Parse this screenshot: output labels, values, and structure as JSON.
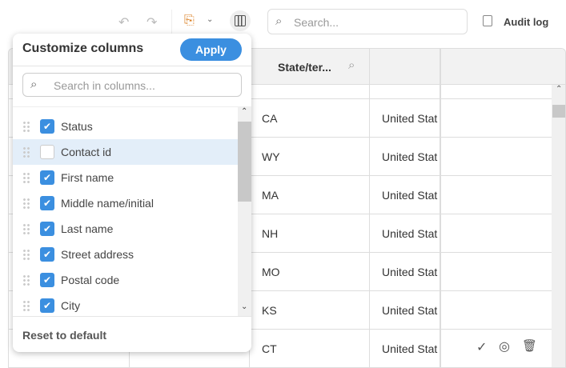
{
  "toolbar": {
    "undo_icon": "undo-icon",
    "redo_icon": "redo-icon",
    "export_icon": "export-icon",
    "columns_icon": "columns-icon",
    "search_placeholder": "Search...",
    "audit_log": "Audit log"
  },
  "table": {
    "header_state": "State/ter...",
    "rows": [
      {
        "state": "CA",
        "country": "United Stat"
      },
      {
        "state": "WY",
        "country": "United Stat"
      },
      {
        "state": "MA",
        "country": "United Stat"
      },
      {
        "state": "NH",
        "country": "United Stat"
      },
      {
        "state": "MO",
        "country": "United Stat"
      },
      {
        "state": "KS",
        "country": "United Stat"
      },
      {
        "state": "CT",
        "country": "United Stat"
      }
    ]
  },
  "popup": {
    "title": "Customize columns",
    "apply": "Apply",
    "search_placeholder": "Search in columns...",
    "reset": "Reset to default",
    "items": [
      {
        "label": "Status",
        "checked": true
      },
      {
        "label": "Contact id",
        "checked": false
      },
      {
        "label": "First name",
        "checked": true
      },
      {
        "label": "Middle name/initial",
        "checked": true
      },
      {
        "label": "Last name",
        "checked": true
      },
      {
        "label": "Street address",
        "checked": true
      },
      {
        "label": "Postal code",
        "checked": true
      },
      {
        "label": "City",
        "checked": true
      }
    ]
  },
  "colors": {
    "accent": "#3b8fe0",
    "highlight": "#e3eef9"
  }
}
